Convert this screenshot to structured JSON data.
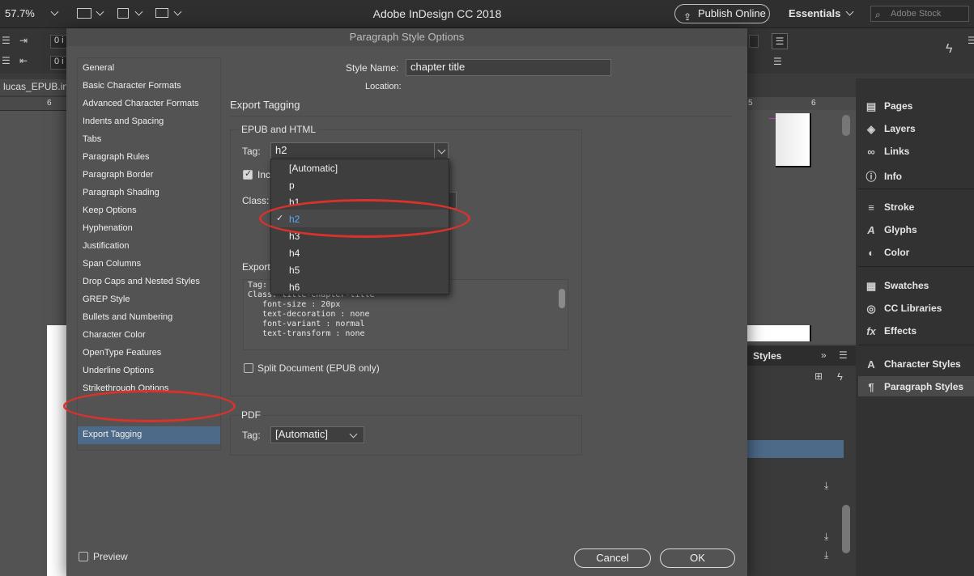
{
  "app": {
    "title": "Adobe InDesign CC 2018",
    "zoom": "57.7%",
    "publish_label": "Publish Online",
    "workspace": "Essentials",
    "stock_placeholder": "Adobe Stock"
  },
  "control_bar": {
    "field_1": "0 i",
    "field_2": "0 i"
  },
  "document": {
    "tab": "lucas_EPUB.indd",
    "ruler_left_tick": "6",
    "ruler_right_ticks": [
      "5",
      "6"
    ]
  },
  "panels": {
    "group1": [
      "Pages",
      "Layers",
      "Links",
      "Info"
    ],
    "group2": [
      "Stroke",
      "Glyphs",
      "Color"
    ],
    "group3": [
      "Swatches",
      "CC Libraries",
      "Effects"
    ],
    "group4": [
      "Character Styles",
      "Paragraph Styles"
    ],
    "styles_tab": "Styles"
  },
  "dialog": {
    "title": "Paragraph Style Options",
    "style_name_label": "Style Name:",
    "style_name_value": "chapter title",
    "location_label": "Location:",
    "section_title": "Export Tagging",
    "categories": [
      "General",
      "Basic Character Formats",
      "Advanced Character Formats",
      "Indents and Spacing",
      "Tabs",
      "Paragraph Rules",
      "Paragraph Border",
      "Paragraph Shading",
      "Keep Options",
      "Hyphenation",
      "Justification",
      "Span Columns",
      "Drop Caps and Nested Styles",
      "GREP Style",
      "Bullets and Numbering",
      "Character Color",
      "OpenType Features",
      "Underline Options",
      "Strikethrough Options",
      "Export Tagging"
    ],
    "selected_category": "Export Tagging",
    "epub": {
      "group_title": "EPUB and HTML",
      "tag_label": "Tag:",
      "tag_value": "h2",
      "include_label": "Inc",
      "class_label": "Class:",
      "export_label": "Export",
      "preview_lines": [
        "Tag: h2",
        "Class: title-chapter-title",
        "   font-size : 20px",
        "   text-decoration : none",
        "   font-variant : normal",
        "   text-transform : none"
      ],
      "split_label": "Split Document (EPUB only)"
    },
    "pdf": {
      "group_title": "PDF",
      "tag_label": "Tag:",
      "tag_value": "[Automatic]"
    },
    "preview_label": "Preview",
    "cancel_label": "Cancel",
    "ok_label": "OK"
  },
  "tag_menu": {
    "options": [
      "[Automatic]",
      "p",
      "h1",
      "h2",
      "h3",
      "h4",
      "h5",
      "h6"
    ],
    "selected": "h2"
  },
  "colors": {
    "highlight": "#d9322c",
    "selection": "#4d6a89",
    "menu_selected_text": "#5aa7ff"
  }
}
